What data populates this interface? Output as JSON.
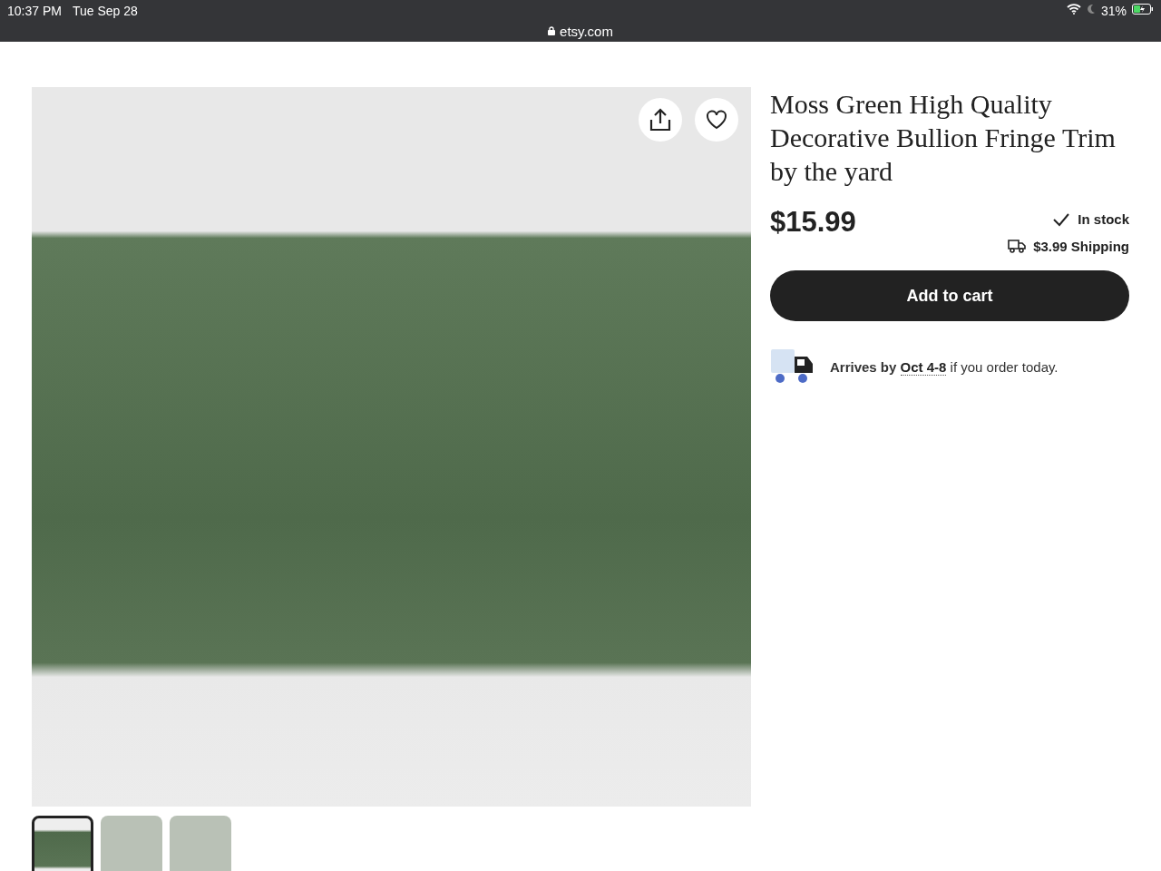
{
  "status_bar": {
    "time": "10:37 PM",
    "date": "Tue Sep 28",
    "url": "etsy.com",
    "battery": "31%"
  },
  "product": {
    "title": "Moss Green High Quality Decorative Bullion Fringe Trim by the yard",
    "price": "$15.99",
    "stock": "In stock",
    "shipping": "$3.99 Shipping",
    "add_to_cart": "Add to cart",
    "delivery": {
      "prefix": "Arrives by",
      "date": "Oct 4-8",
      "suffix": "if you order today."
    }
  },
  "thumbnails": [
    {
      "selected": true
    },
    {
      "selected": false
    },
    {
      "selected": false
    }
  ]
}
